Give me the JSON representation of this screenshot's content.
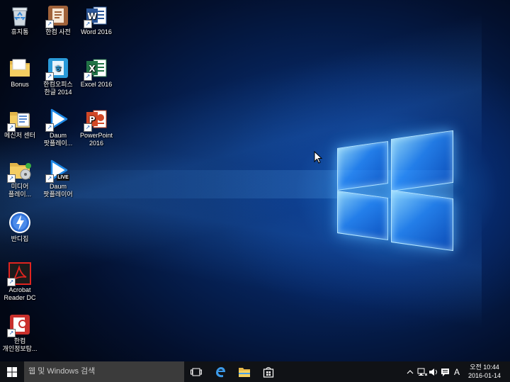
{
  "desktop_icons": [
    {
      "label": "휴지통"
    },
    {
      "label": "한컴 사전"
    },
    {
      "label": "Word 2016"
    },
    {
      "label": "Bonus"
    },
    {
      "label": "한컴오피스\n한글 2014"
    },
    {
      "label": "Excel 2016"
    },
    {
      "label": "메신저 센터"
    },
    {
      "label": "Daum\n팟플레이..."
    },
    {
      "label": "PowerPoint\n2016"
    },
    {
      "label": "미디어\n플레이..."
    },
    {
      "label": "Daum\n팟플레이어"
    },
    {
      "label": "반디집"
    },
    {
      "label": "Acrobat\nReader DC"
    },
    {
      "label": "한컴\n개인정보탐..."
    }
  ],
  "taskbar": {
    "search_placeholder": "웹 및 Windows 검색",
    "ime_indicator": "A",
    "clock": {
      "period_time": "오전 10:44",
      "date": "2016-01-14"
    }
  },
  "live_badge": "LIVE"
}
